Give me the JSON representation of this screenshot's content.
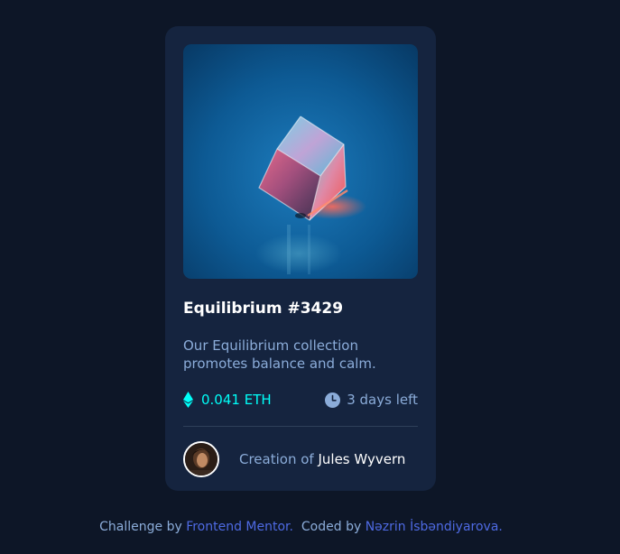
{
  "card": {
    "image_alt": "Equilibrium cube",
    "title": "Equilibrium #3429",
    "description": "Our Equilibrium collection promotes balance and calm.",
    "price": {
      "icon": "ethereum-icon",
      "value": "0.041 ETH"
    },
    "time": {
      "icon": "clock-icon",
      "value": "3 days left"
    },
    "creator": {
      "prefix": "Creation of",
      "name": "Jules Wyvern"
    }
  },
  "attribution": {
    "challenge_prefix": "Challenge by",
    "challenge_link": "Frontend Mentor.",
    "coded_prefix": "Coded by",
    "coded_link": "Nəzrin İsbəndiyarova."
  },
  "colors": {
    "page_bg": "#0d1627",
    "card_bg": "#15243f",
    "accent": "#00fff8",
    "muted_text": "#8bacd9",
    "link": "#4e6ae3"
  }
}
